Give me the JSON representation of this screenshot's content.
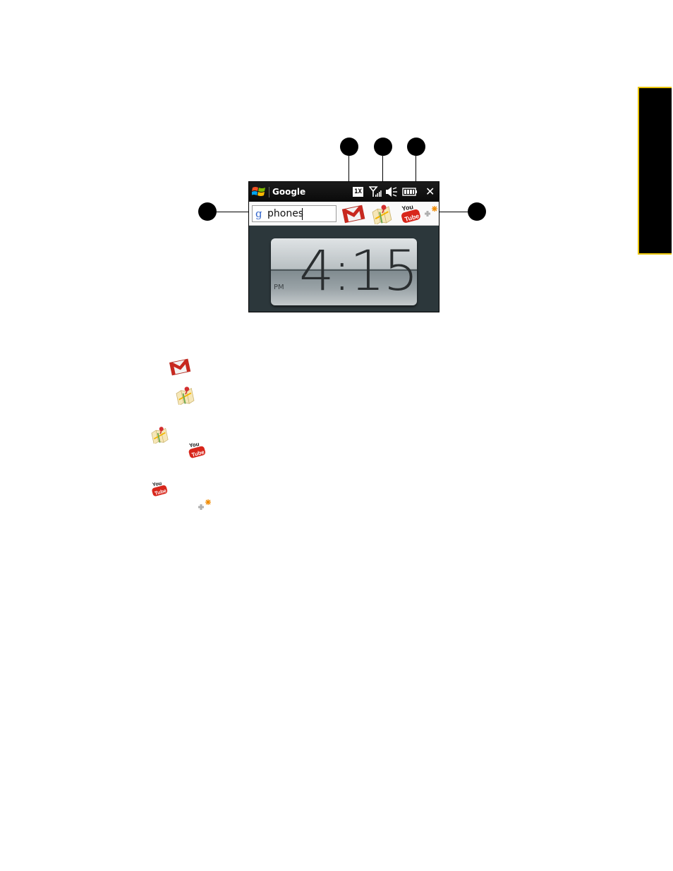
{
  "titlebar": {
    "app_title": "Google",
    "network_badge": "1X",
    "close_label": "✕"
  },
  "search": {
    "value": "phones",
    "logo_letter": "g"
  },
  "clock": {
    "time": "4:15",
    "ampm": "PM"
  },
  "icons": {
    "gmail": "gmail-icon",
    "maps": "maps-icon",
    "youtube": "youtube-icon",
    "add": "add-shortcut-icon",
    "windows": "windows-start-icon",
    "signal": "signal-icon",
    "volume": "speaker-muted-icon",
    "battery": "battery-icon"
  },
  "youtube": {
    "top": "You",
    "bottom": "Tube"
  },
  "colors": {
    "side_tab_border": "#e8c300",
    "gmail_red": "#c8281f",
    "youtube_red": "#d8261b",
    "add_orange": "#f08a00"
  }
}
